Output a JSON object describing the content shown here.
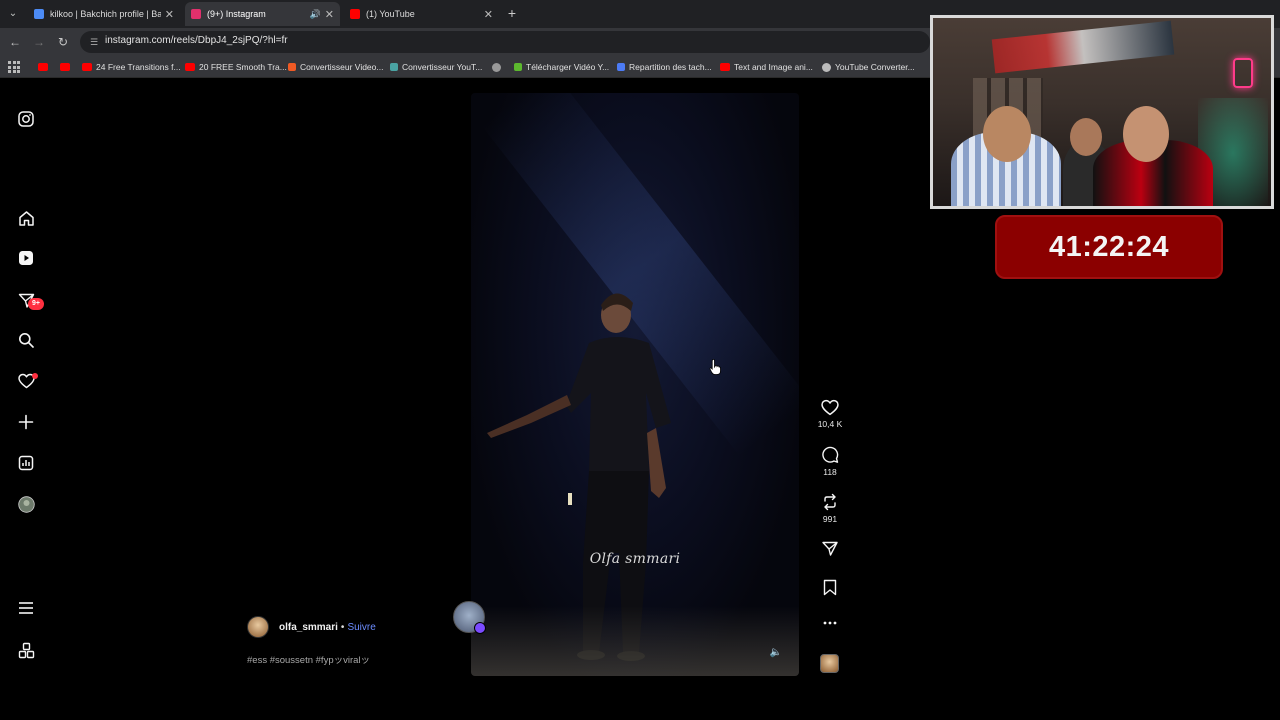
{
  "browser": {
    "tabs": [
      {
        "title": "kilkoo | Bakchich profile | Bakchic",
        "active": false,
        "favicon_color": "#4c8bf5"
      },
      {
        "title": "(9+) Instagram",
        "active": true,
        "favicon_color": "#e1306c"
      },
      {
        "title": "(1) YouTube",
        "active": false,
        "favicon_color": "#ff0000"
      }
    ],
    "url": "instagram.com/reels/DbpJ4_2sjPQ/?hl=fr",
    "bookmarks": [
      {
        "label": "",
        "color": "#ff0000"
      },
      {
        "label": "",
        "color": "#ff0000"
      },
      {
        "label": "24 Free Transitions f...",
        "color": "#ff0000"
      },
      {
        "label": "20 FREE Smooth Tra...",
        "color": "#ff0000"
      },
      {
        "label": "Convertisseur Video...",
        "color": "#f05a24"
      },
      {
        "label": "Convertisseur YouT...",
        "color": "#4aa3a3"
      },
      {
        "label": "",
        "color": "#999999"
      },
      {
        "label": "Télécharger Vidéo Y...",
        "color": "#5cb82e"
      },
      {
        "label": "Repartition des tach...",
        "color": "#4c7bf5"
      },
      {
        "label": "Text and Image ani...",
        "color": "#ff0000"
      },
      {
        "label": "YouTube Converter...",
        "color": "#bbbbbb"
      }
    ]
  },
  "sidebar": {
    "icons": [
      "instagram-logo-icon",
      "home-icon",
      "reels-icon",
      "direct-messages-icon",
      "search-icon",
      "notifications-heart-icon",
      "create-plus-icon",
      "dashboard-icon",
      "profile-avatar-icon",
      "menu-icon",
      "more-apps-icon"
    ],
    "messages_badge": "9+"
  },
  "reel": {
    "watermark": "Olfa smmari",
    "author": "olfa_smmari",
    "separator": "•",
    "follow_label": "Suivre",
    "caption": "#ess #soussetn #fypッviralッ",
    "likes": "10,4 K",
    "comments": "118",
    "reposts": "991"
  },
  "overlay": {
    "timer": "41:22:24"
  },
  "colors": {
    "follow_link": "#6c8cff",
    "badge": "#ff3040",
    "timer_bg": "#8b0000"
  }
}
